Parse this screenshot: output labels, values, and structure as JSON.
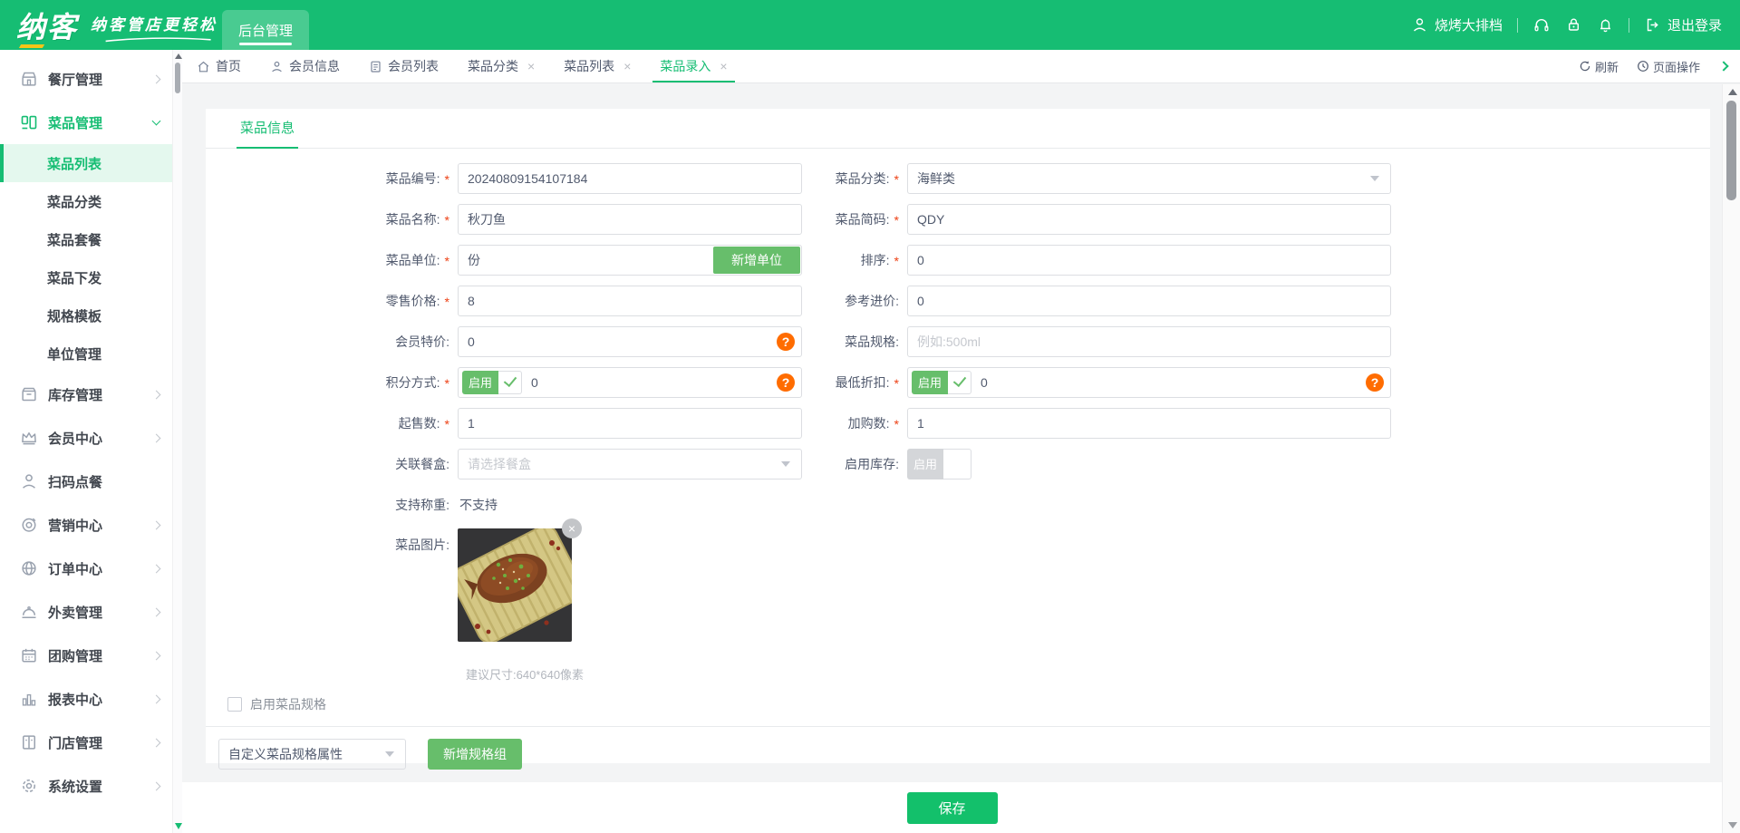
{
  "ui": {
    "star": "*",
    "question": "?",
    "close_x": "×"
  },
  "colors": {
    "brand_green": "#16bd73",
    "button_green": "#67be6b",
    "help_orange": "#ff6c00",
    "required_red": "#ed4014",
    "save_green": "#13c06b"
  },
  "header": {
    "logo": "纳客",
    "slogan": "纳客管店更轻松",
    "nav_tab": "后台管理",
    "user": "烧烤大排档",
    "logout_label": "退出登录",
    "icons": [
      "user-icon",
      "headset-icon",
      "lock-icon",
      "bell-icon",
      "logout-icon"
    ]
  },
  "sidebar": {
    "items": [
      {
        "label": "餐厅管理",
        "icon": "restaurant-icon"
      },
      {
        "label": "菜品管理",
        "icon": "dish-icon",
        "children": [
          "菜品列表",
          "菜品分类",
          "菜品套餐",
          "菜品下发",
          "规格模板",
          "单位管理"
        ],
        "active_child": "菜品列表"
      },
      {
        "label": "库存管理",
        "icon": "inventory-icon"
      },
      {
        "label": "会员中心",
        "icon": "crown-icon"
      },
      {
        "label": "扫码点餐",
        "icon": "person-icon"
      },
      {
        "label": "营销中心",
        "icon": "target-icon"
      },
      {
        "label": "订单中心",
        "icon": "globe-icon"
      },
      {
        "label": "外卖管理",
        "icon": "cloche-icon"
      },
      {
        "label": "团购管理",
        "icon": "calendar-icon"
      },
      {
        "label": "报表中心",
        "icon": "chart-icon"
      },
      {
        "label": "门店管理",
        "icon": "store-icon"
      },
      {
        "label": "系统设置",
        "icon": "gear-icon"
      }
    ]
  },
  "tabbar": {
    "tabs": [
      {
        "label": "首页",
        "icon": "home-icon"
      },
      {
        "label": "会员信息",
        "icon": "member-icon"
      },
      {
        "label": "会员列表",
        "icon": "list-icon"
      },
      {
        "label": "菜品分类",
        "closable": true
      },
      {
        "label": "菜品列表",
        "closable": true
      },
      {
        "label": "菜品录入",
        "closable": true,
        "active": true
      }
    ],
    "refresh": "刷新",
    "page_ops": "页面操作"
  },
  "panel": {
    "tab": "菜品信息"
  },
  "form": {
    "code": {
      "label": "菜品编号:",
      "required": true,
      "value": "20240809154107184"
    },
    "category": {
      "label": "菜品分类:",
      "required": true,
      "value": "海鲜类"
    },
    "name": {
      "label": "菜品名称:",
      "required": true,
      "value": "秋刀鱼"
    },
    "short_code": {
      "label": "菜品简码:",
      "required": true,
      "value": "QDY"
    },
    "unit": {
      "label": "菜品单位:",
      "required": true,
      "value": "份",
      "add_button": "新增单位"
    },
    "sort": {
      "label": "排序:",
      "required": true,
      "value": "0"
    },
    "retail_price": {
      "label": "零售价格:",
      "required": true,
      "value": "8"
    },
    "reference_price": {
      "label": "参考进价:",
      "required": false,
      "value": "0"
    },
    "member_price": {
      "label": "会员特价:",
      "required": false,
      "value": "0"
    },
    "spec": {
      "label": "菜品规格:",
      "required": false,
      "placeholder": "例如:500ml"
    },
    "points_mode": {
      "label": "积分方式:",
      "required": true,
      "toggle": "启用",
      "value": "0"
    },
    "min_discount": {
      "label": "最低折扣:",
      "required": true,
      "toggle": "启用",
      "value": "0"
    },
    "min_sale": {
      "label": "起售数:",
      "required": true,
      "value": "1"
    },
    "add_purchase": {
      "label": "加购数:",
      "required": true,
      "value": "1"
    },
    "meal_box": {
      "label": "关联餐盒:",
      "required": false,
      "placeholder": "请选择餐盒"
    },
    "stock": {
      "label": "启用库存:",
      "required": false,
      "toggle": "启用"
    },
    "weighing": {
      "label": "支持称重:",
      "required": false,
      "value": "不支持"
    },
    "image": {
      "label": "菜品图片:",
      "hint": "建议尺寸:640*640像素"
    },
    "enable_spec_checkbox": "启用菜品规格",
    "spec_select": "自定义菜品规格属性",
    "add_spec_group": "新增规格组",
    "save": "保存"
  }
}
